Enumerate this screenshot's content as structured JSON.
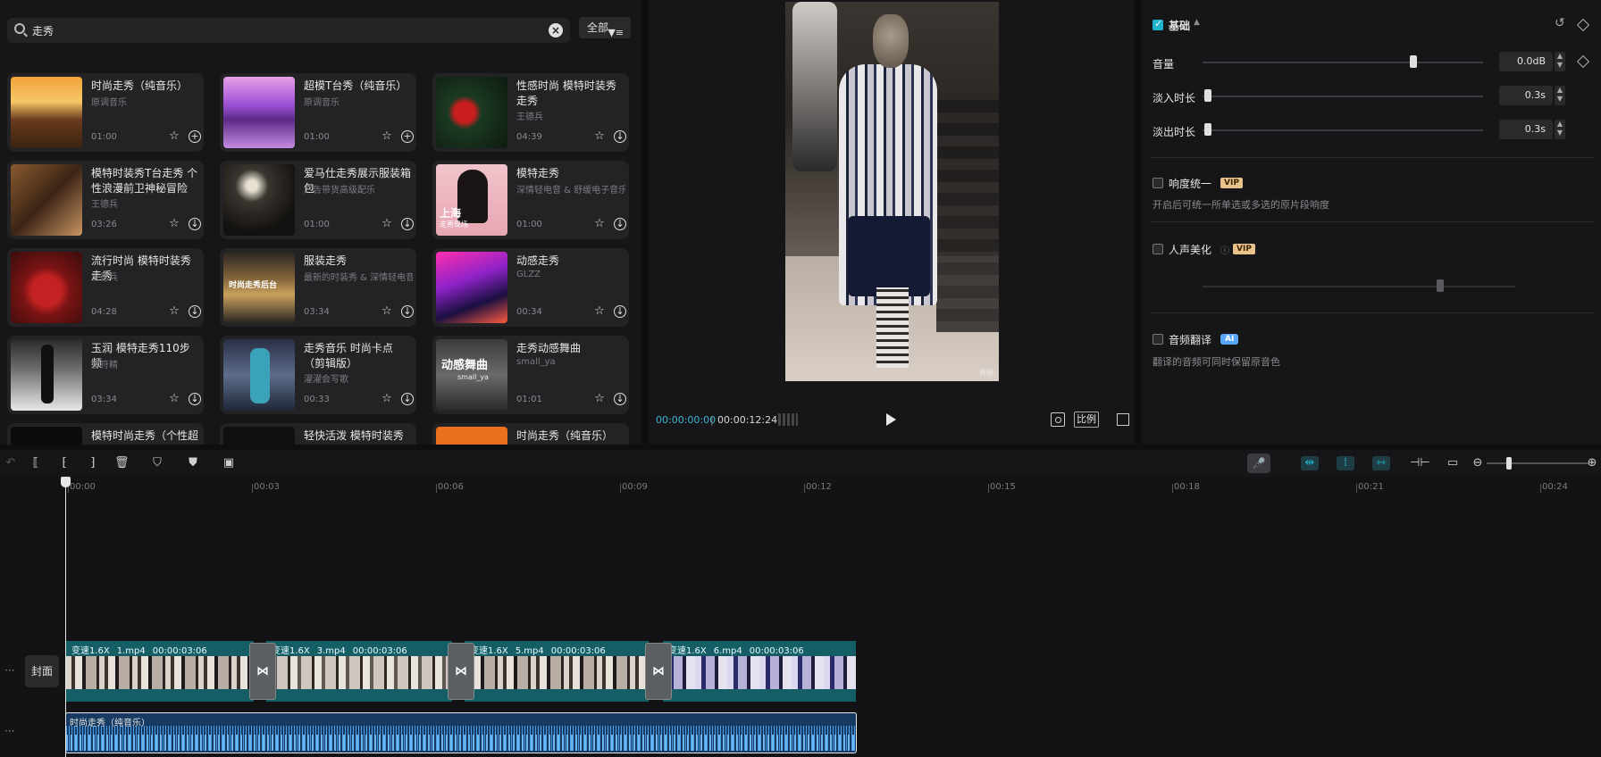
{
  "search": {
    "query": "走秀",
    "filter_label": "全部"
  },
  "library": {
    "cards": [
      {
        "title": "时尚走秀（纯音乐）",
        "sub": "原调音乐",
        "dur": "01:00",
        "action": "+"
      },
      {
        "title": "超模T台秀（纯音乐）",
        "sub": "原调音乐",
        "dur": "01:00",
        "action": "+"
      },
      {
        "title": "性感时尚 模特时装秀走秀",
        "sub": "王德兵",
        "dur": "04:39",
        "action": "↓"
      },
      {
        "title": "模特时装秀T台走秀 个性浪漫前卫神秘冒险",
        "sub": "王德兵",
        "dur": "03:26",
        "action": "↓"
      },
      {
        "title": "爱马仕走秀展示服装箱包",
        "sub": "广告带货高级配乐",
        "dur": "01:00",
        "action": "↓"
      },
      {
        "title": "模特走秀",
        "sub": "深情轻电音 & 舒缓电子音乐",
        "dur": "01:00",
        "action": "↓"
      },
      {
        "title": "流行时尚 模特时装秀走秀",
        "sub": "王德兵",
        "dur": "04:28",
        "action": "↓"
      },
      {
        "title": "服装走秀",
        "sub": "最新的时装秀 & 深情轻电音",
        "dur": "03:34",
        "action": "↓"
      },
      {
        "title": "动感走秀",
        "sub": "GLZZ",
        "dur": "00:34",
        "action": "↓"
      },
      {
        "title": "玉润 模特走秀110步频",
        "sub": "音符精",
        "dur": "03:34",
        "action": "↓"
      },
      {
        "title": "走秀音乐 时尚卡点（剪辑版）",
        "sub": "濯濯会写歌",
        "dur": "00:33",
        "action": "↓"
      },
      {
        "title": "走秀动感舞曲",
        "sub": "small_ya",
        "dur": "01:01",
        "action": "↓"
      },
      {
        "title": "模特时尚走秀（个性超有范",
        "sub": "",
        "dur": "",
        "action": ""
      },
      {
        "title": "轻快活泼 模特时装秀走秀",
        "sub": "",
        "dur": "",
        "action": ""
      },
      {
        "title": "时尚走秀（纯音乐）",
        "sub": "",
        "dur": "",
        "action": ""
      }
    ],
    "thumb_texts": {
      "t5": "上海",
      "t5b": "走秀现场",
      "t8": "时尚走秀后台",
      "t12": "动感舞曲",
      "t12b": "small_ya"
    }
  },
  "player": {
    "current_time": "00:00:00:00",
    "total_time": "00:00:12:24",
    "ratio_label": "比例",
    "video_watermark": "剪映"
  },
  "props": {
    "basic": {
      "label": "基础",
      "checked": true
    },
    "volume": {
      "label": "音量",
      "value": "0.0dB",
      "level": 0.75
    },
    "fade_in": {
      "label": "淡入时长",
      "value": "0.3s",
      "level": 0.02
    },
    "fade_out": {
      "label": "淡出时长",
      "value": "0.3s",
      "level": 0.02
    },
    "loudness": {
      "label": "响度统一",
      "badge": "VIP",
      "desc": "开启后可统一所单选或多选的原片段响度"
    },
    "voice": {
      "label": "人声美化",
      "badge": "VIP"
    },
    "translate": {
      "label": "音频翻译",
      "badge": "AI",
      "desc": "翻译的音频可同时保留原音色"
    }
  },
  "timeline": {
    "ruler": [
      "00:00",
      "00:03",
      "00:06",
      "00:09",
      "00:12",
      "00:15",
      "00:18",
      "00:21",
      "00:24"
    ],
    "cover_label": "封面",
    "clips": [
      {
        "speed": "变速1.6X",
        "name": "1.mp4",
        "duration": "00:00:03:06"
      },
      {
        "speed": "变速1.6X",
        "name": "3.mp4",
        "duration": "00:00:03:06"
      },
      {
        "speed": "变速1.6X",
        "name": "5.mp4",
        "duration": "00:00:03:06"
      },
      {
        "speed": "变速1.6X",
        "name": "6.mp4",
        "duration": "00:00:03:06"
      }
    ],
    "audio_label": "时尚走秀（纯音乐）"
  },
  "colors": {
    "accent": "#20b2c9",
    "clip": "#155e66",
    "audio": "#173a63",
    "vip": "#e8c28a",
    "ai": "#5aa6ff"
  }
}
